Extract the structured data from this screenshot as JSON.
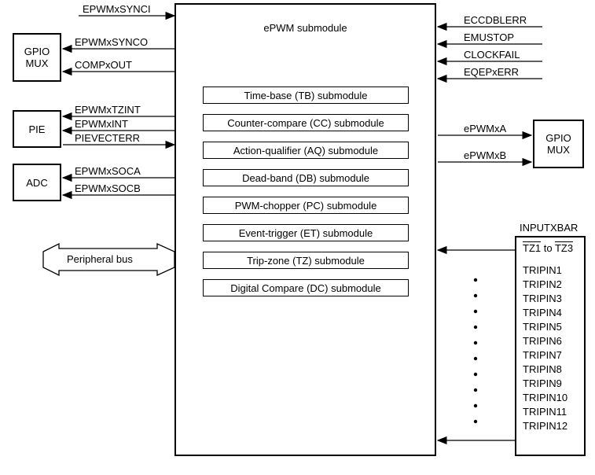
{
  "main": {
    "title": "ePWM submodule",
    "submodules": [
      "Time-base (TB) submodule",
      "Counter-compare (CC) submodule",
      "Action-qualifier (AQ) submodule",
      "Dead-band (DB) submodule",
      "PWM-chopper (PC) submodule",
      "Event-trigger (ET) submodule",
      "Trip-zone (TZ) submodule",
      "Digital Compare (DC) submodule"
    ]
  },
  "left_blocks": {
    "gpio": "GPIO\nMUX",
    "pie": "PIE",
    "adc": "ADC"
  },
  "right_blocks": {
    "gpio": "GPIO\nMUX",
    "xbar_title": "INPUTXBAR",
    "xbar_first": "TZ1 to TZ3",
    "xbar_items": [
      "TRIPIN1",
      "TRIPIN2",
      "TRIPIN3",
      "TRIPIN4",
      "TRIPIN5",
      "TRIPIN6",
      "TRIPIN7",
      "TRIPIN8",
      "TRIPIN9",
      "TRIPIN10",
      "TRIPIN11",
      "TRIPIN12"
    ]
  },
  "signals": {
    "top_left_in": "EPWMxSYNCI",
    "gpio_out1": "EPWMxSYNCO",
    "gpio_out2": "COMPxOUT",
    "pie1": "EPWMxTZINT",
    "pie2": "EPWMxINT",
    "pie3": "PIEVECTERR",
    "adc1": "EPWMxSOCA",
    "adc2": "EPWMxSOCB",
    "bus": "Peripheral bus",
    "right_in1": "ECCDBLERR",
    "right_in2": "EMUSTOP",
    "right_in3": "CLOCKFAIL",
    "right_in4": "EQEPxERR",
    "right_gpio1": "ePWMxA",
    "right_gpio2": "ePWMxB"
  }
}
